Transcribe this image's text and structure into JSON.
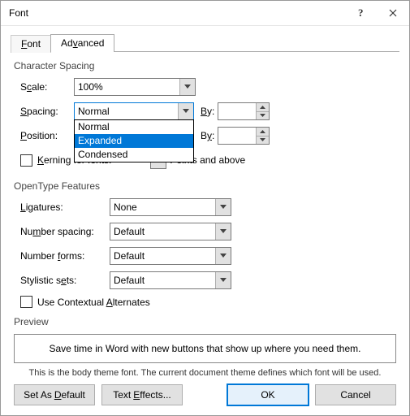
{
  "title": "Font",
  "tabs": {
    "font": "Font",
    "advanced": "Advanced"
  },
  "groups": {
    "charSpacing": "Character Spacing",
    "openType": "OpenType Features",
    "preview": "Preview"
  },
  "charSpacing": {
    "scaleLabel": "Scale:",
    "scaleValue": "100%",
    "spacingLabel": "Spacing:",
    "spacingValue": "Normal",
    "positionLabel": "Position:",
    "byLabel": "By:",
    "kerningLabel": "Kerning for fonts:",
    "pointsAbove": "Points and above",
    "options": [
      "Normal",
      "Expanded",
      "Condensed"
    ],
    "selectedIndex": 1
  },
  "openType": {
    "ligaturesLabel": "Ligatures:",
    "ligaturesValue": "None",
    "numSpacingLabel": "Number spacing:",
    "numSpacingValue": "Default",
    "numFormsLabel": "Number forms:",
    "numFormsValue": "Default",
    "stylisticLabel": "Stylistic sets:",
    "stylisticValue": "Default",
    "contextualAlt": "Use Contextual Alternates"
  },
  "preview": {
    "sample": "Save time in Word with new buttons that show up where you need them.",
    "hint": "This is the body theme font. The current document theme defines which font will be used."
  },
  "footer": {
    "setDefault": "Set As Default",
    "textEffects": "Text Effects...",
    "ok": "OK",
    "cancel": "Cancel"
  }
}
